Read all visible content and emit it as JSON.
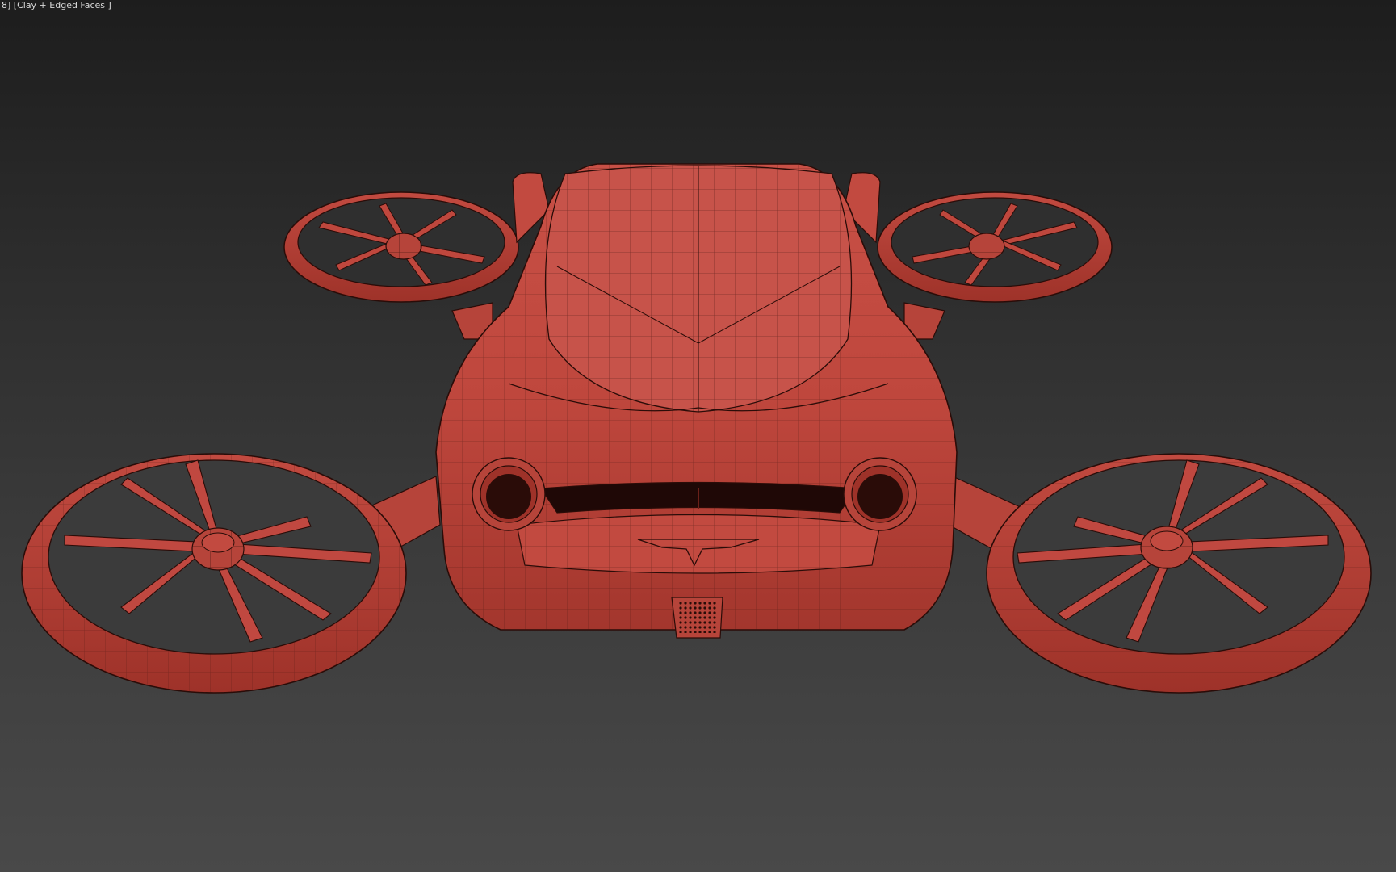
{
  "viewport": {
    "label": "8] [Clay + Edged Faces ]",
    "shading_mode": "Clay + Edged Faces",
    "background_colors": [
      "#1d1d1d",
      "#494949"
    ],
    "model_color": "#c0473c",
    "edge_color": "#2a0c08"
  },
  "model": {
    "name": "flying-car-with-four-ducted-rotors"
  }
}
